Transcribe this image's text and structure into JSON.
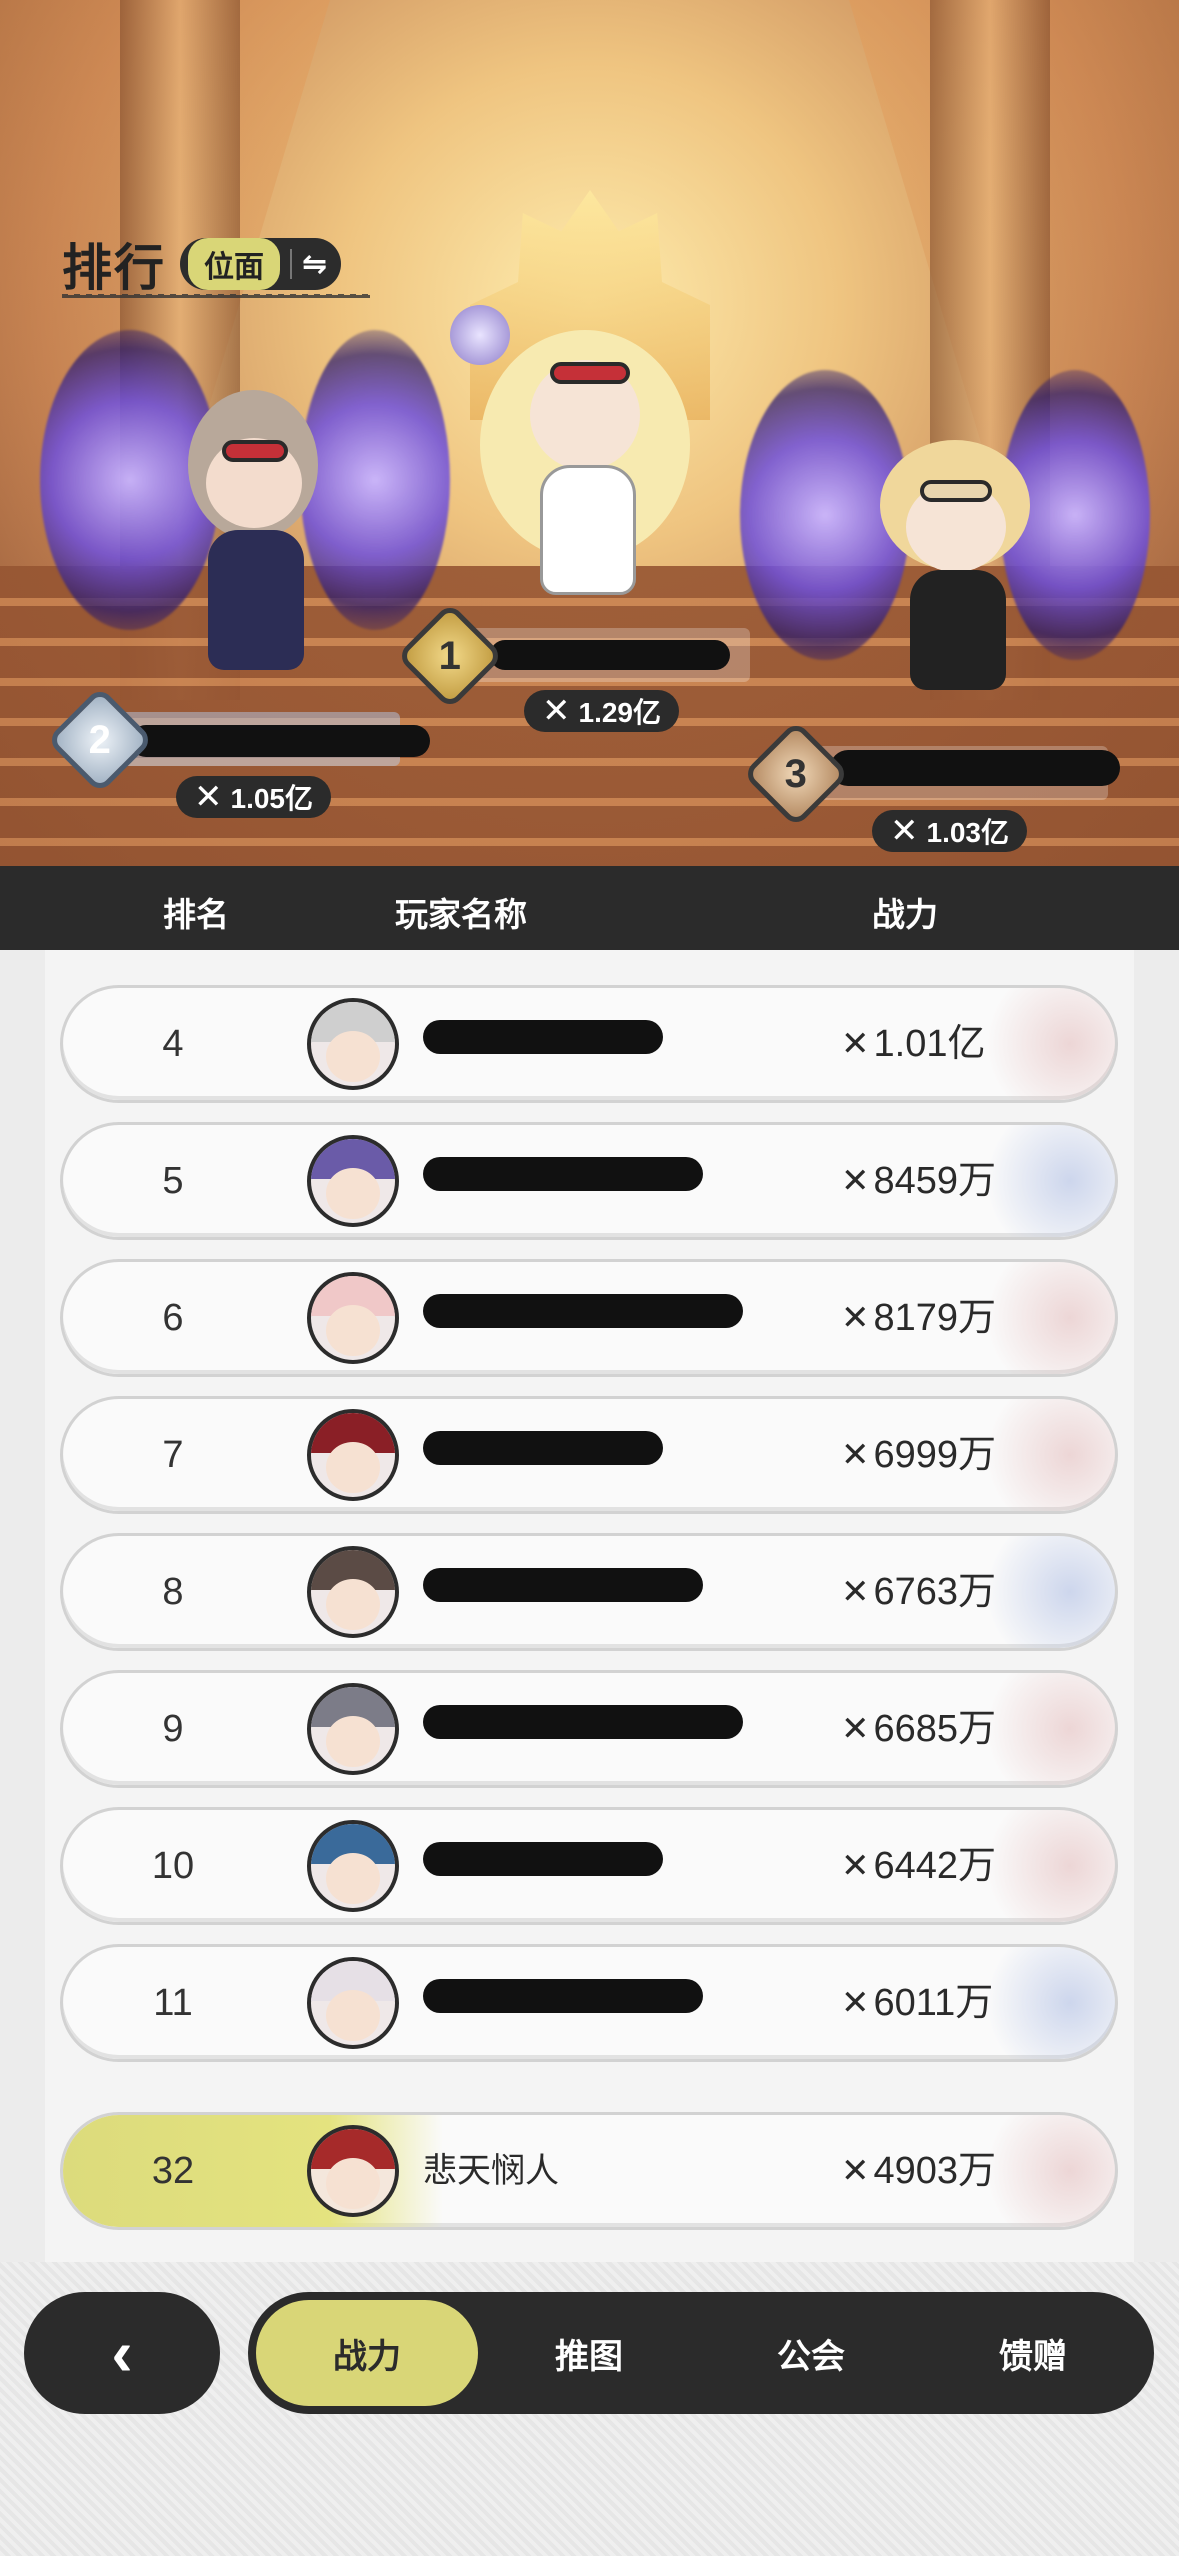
{
  "header": {
    "title": "排行",
    "plane_label": "位面",
    "switch_icon": "⇋"
  },
  "podium": [
    {
      "rank": "1",
      "power": "1.29亿",
      "name_hidden": true,
      "badge": "gold"
    },
    {
      "rank": "2",
      "power": "1.05亿",
      "name_hidden": true,
      "badge": "silver"
    },
    {
      "rank": "3",
      "power": "1.03亿",
      "name_hidden": true,
      "badge": "bronze"
    }
  ],
  "columns": {
    "rank": "排名",
    "player": "玩家名称",
    "power": "战力"
  },
  "icons": {
    "power": "crossed-swords-icon",
    "back": "chevron-left-icon"
  },
  "rows": [
    {
      "rank": "4",
      "name": "",
      "power": "1.01亿"
    },
    {
      "rank": "5",
      "name": "",
      "power": "8459万"
    },
    {
      "rank": "6",
      "name": "",
      "power": "8179万"
    },
    {
      "rank": "7",
      "name": "",
      "power": "6999万"
    },
    {
      "rank": "8",
      "name": "",
      "power": "6763万"
    },
    {
      "rank": "9",
      "name": "",
      "power": "6685万"
    },
    {
      "rank": "10",
      "name": "",
      "power": "6442万"
    },
    {
      "rank": "11",
      "name": "",
      "power": "6011万"
    }
  ],
  "self": {
    "rank": "32",
    "name": "悲天悯人",
    "power": "4903万"
  },
  "nav": {
    "back": "‹",
    "tabs": [
      {
        "label": "战力",
        "active": true
      },
      {
        "label": "推图",
        "active": false
      },
      {
        "label": "公会",
        "active": false
      },
      {
        "label": "馈赠",
        "active": false
      }
    ]
  },
  "colors": {
    "accent": "#d9d677",
    "dark": "#2b2b2b"
  }
}
